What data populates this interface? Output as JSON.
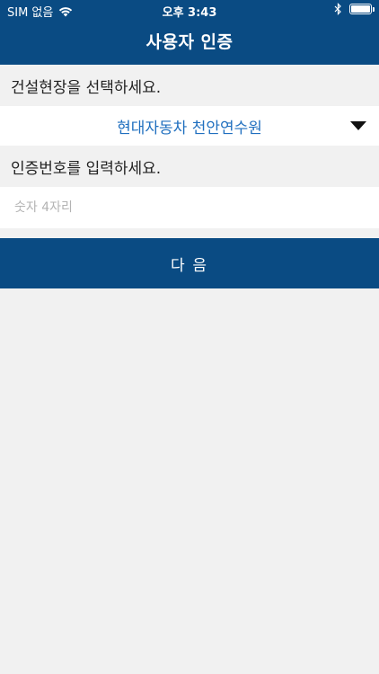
{
  "status_bar": {
    "carrier": "SIM 없음",
    "time": "오후 3:43",
    "wifi_icon": "wifi-icon",
    "bluetooth_icon": "bluetooth-icon",
    "battery_level": 1.0
  },
  "nav": {
    "title": "사용자 인증"
  },
  "site": {
    "label": "건설현장을 선택하세요.",
    "selected": "현대자동차 천안연수원",
    "icon": "chevron-down-icon"
  },
  "auth": {
    "label": "인증번호를 입력하세요.",
    "value": "",
    "placeholder": "숫자 4자리"
  },
  "actions": {
    "next_label": "다 음"
  },
  "colors": {
    "primary": "#0a4b83",
    "link_blue": "#1f6fbf",
    "background": "#f1f1f1"
  }
}
